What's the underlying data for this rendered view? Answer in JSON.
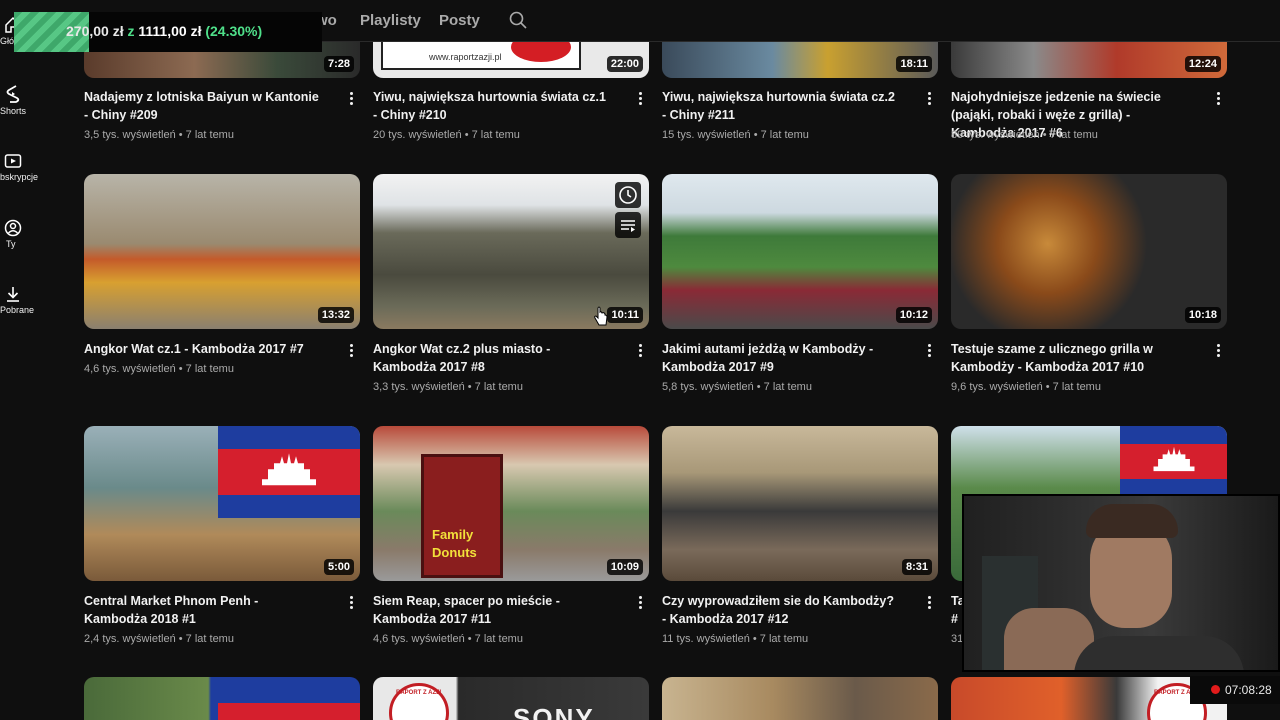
{
  "progress": {
    "current": "270,00 zł",
    "word": "z",
    "total": "1111,00 zł",
    "percent": "(24.30%)",
    "fraction": 0.243
  },
  "tabs": {
    "partial": "wo",
    "playlisty": "Playlisty",
    "posty": "Posty"
  },
  "sidebar": {
    "home": "Główna",
    "shorts": "Shorts",
    "subs": "bskrypcje",
    "you": "Ty",
    "downloads": "Pobrane"
  },
  "row0": [
    {
      "title": "Nadajemy z lotniska Baiyun w Kantonie - Chiny #209",
      "meta": "3,5 tys. wyświetleń • 7 lat temu",
      "duration": "7:28"
    },
    {
      "title": "Yiwu, największa hurtownia świata cz.1 - Chiny #210",
      "meta": "20 tys. wyświetleń • 7 lat temu",
      "duration": "22:00",
      "sign": "www.raportzazji.pl"
    },
    {
      "title": "Yiwu, największa hurtownia świata cz.2 - Chiny #211",
      "meta": "15 tys. wyświetleń • 7 lat temu",
      "duration": "18:11"
    },
    {
      "title": "Najohydniejsze jedzenie na świecie (pająki, robaki i węże z grilla) - Kambodża 2017 #6",
      "meta": "89 tys. wyświetleń • 7 lat temu",
      "duration": "12:24"
    }
  ],
  "row1": [
    {
      "title": "Angkor Wat cz.1 - Kambodża 2017 #7",
      "meta": "4,6 tys. wyświetleń • 7 lat temu",
      "duration": "13:32"
    },
    {
      "title": "Angkor Wat cz.2 plus miasto - Kambodża 2017 #8",
      "meta": "3,3 tys. wyświetleń • 7 lat temu",
      "duration": "10:11"
    },
    {
      "title": "Jakimi autami jeżdżą w Kambodży - Kambodża 2017 #9",
      "meta": "5,8 tys. wyświetleń • 7 lat temu",
      "duration": "10:12"
    },
    {
      "title": "Testuje szame z ulicznego grilla w Kambodży - Kambodża 2017 #10",
      "meta": "9,6 tys. wyświetleń • 7 lat temu",
      "duration": "10:18"
    }
  ],
  "row2": [
    {
      "title": "Central Market Phnom Penh - Kambodża 2018 #1",
      "meta": "2,4 tys. wyświetleń • 7 lat temu",
      "duration": "5:00"
    },
    {
      "title": "Siem Reap, spacer po mieście - Kambodża 2017 #11",
      "meta": "4,6 tys. wyświetleń • 7 lat temu",
      "duration": "10:09",
      "sign1": "Family",
      "sign2": "Donuts"
    },
    {
      "title": "Czy wyprowadziłem sie do Kambodży? - Kambodża 2017 #12",
      "meta": "11 tys. wyświetleń • 7 lat temu",
      "duration": "8:31"
    },
    {
      "title": "Ta",
      "title2": "#",
      "meta": "31"
    }
  ],
  "row3": [
    {
      "text": ""
    },
    {
      "logo": "RAPORT Z AZJI",
      "sign": "SONY"
    },
    {},
    {
      "logo": "RAPORT Z AZJI"
    }
  ],
  "recording": {
    "time": "07:08:28"
  }
}
